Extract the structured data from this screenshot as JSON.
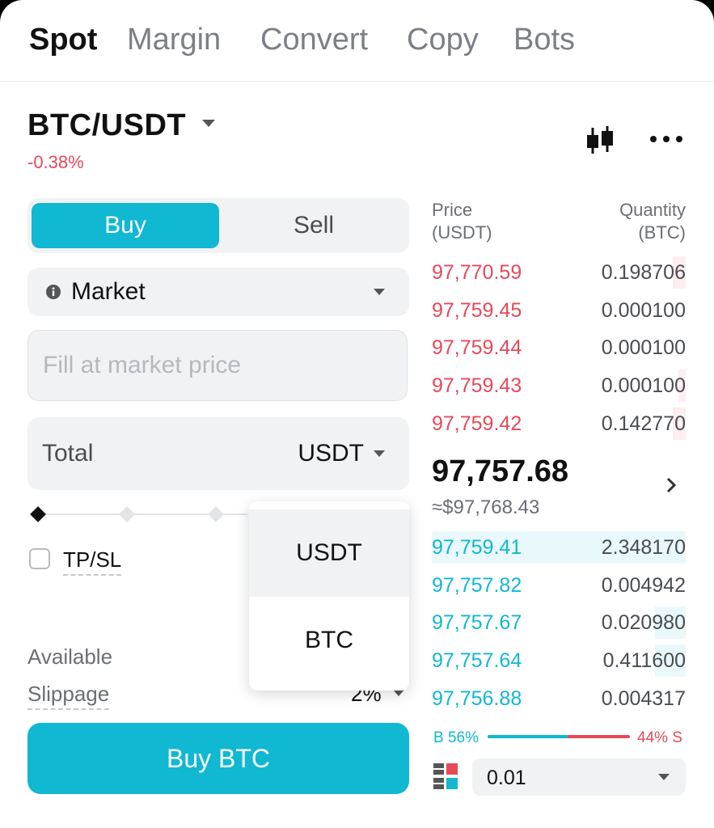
{
  "tabs": [
    {
      "label": "Spot",
      "active": true
    },
    {
      "label": "Margin",
      "active": false
    },
    {
      "label": "Convert",
      "active": false
    },
    {
      "label": "Copy",
      "active": false
    },
    {
      "label": "Bots",
      "active": false
    }
  ],
  "market": {
    "pair": "BTC/USDT",
    "change": "-0.38%"
  },
  "header_icons": {
    "chart": "candlestick-chart-icon",
    "more": "more-options-icon"
  },
  "order_form": {
    "side": {
      "buy": "Buy",
      "sell": "Sell",
      "selected": "Buy"
    },
    "order_type": "Market",
    "price_placeholder": "Fill at market price",
    "total_label": "Total",
    "total_unit": "USDT",
    "slider_stops": 5,
    "slider_value": 0,
    "tpsl_label": "TP/SL",
    "tpsl_checked": false,
    "available_label": "Available",
    "slippage_label": "Slippage",
    "slippage_value": "2%",
    "submit_label": "Buy BTC"
  },
  "unit_dropdown": {
    "options": [
      "USDT",
      "BTC"
    ],
    "selected": "USDT"
  },
  "order_book": {
    "price_header": {
      "line1": "Price",
      "line2": "(USDT)"
    },
    "qty_header": {
      "line1": "Quantity",
      "line2": "(BTC)"
    },
    "asks": [
      {
        "price": "97,770.59",
        "qty": "0.198706",
        "depth": 0.05
      },
      {
        "price": "97,759.45",
        "qty": "0.000100",
        "depth": 0.0
      },
      {
        "price": "97,759.44",
        "qty": "0.000100",
        "depth": 0.0
      },
      {
        "price": "97,759.43",
        "qty": "0.000100",
        "depth": 0.03
      },
      {
        "price": "97,759.42",
        "qty": "0.142770",
        "depth": 0.05
      }
    ],
    "last_price": "97,757.68",
    "last_price_usd": "≈$97,768.43",
    "bids": [
      {
        "price": "97,759.41",
        "qty": "2.348170",
        "depth": 1.0
      },
      {
        "price": "97,757.82",
        "qty": "0.004942",
        "depth": 0.0
      },
      {
        "price": "97,757.67",
        "qty": "0.020980",
        "depth": 0.12
      },
      {
        "price": "97,757.64",
        "qty": "0.411600",
        "depth": 0.12
      },
      {
        "price": "97,756.88",
        "qty": "0.004317",
        "depth": 0.0
      }
    ],
    "ratio": {
      "buy_label": "B 56%",
      "sell_label": "44% S",
      "buy_fraction": 0.56
    },
    "precision": "0.01"
  },
  "colors": {
    "accent": "#10b8d2",
    "down": "#e5495a"
  }
}
